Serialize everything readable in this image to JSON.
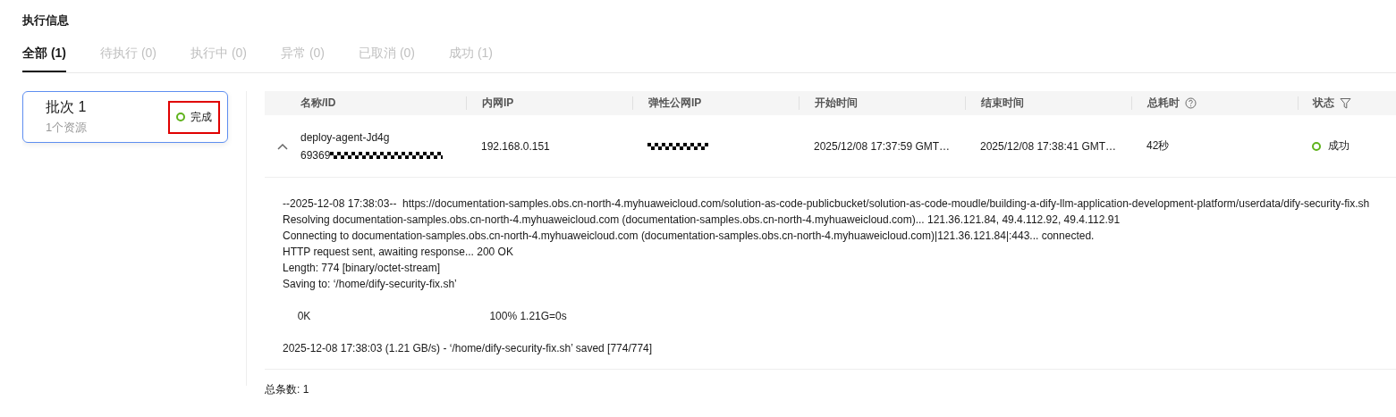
{
  "section_title": "执行信息",
  "tabs": [
    {
      "label": "全部 (1)",
      "selected": true
    },
    {
      "label": "待执行 (0)",
      "selected": false
    },
    {
      "label": "执行中 (0)",
      "selected": false
    },
    {
      "label": "异常 (0)",
      "selected": false
    },
    {
      "label": "已取消 (0)",
      "selected": false
    },
    {
      "label": "成功 (1)",
      "selected": false
    }
  ],
  "batches": [
    {
      "name": "批次 1",
      "resources": "1个资源",
      "status": "完成",
      "selected": true,
      "highlighted": true
    }
  ],
  "table": {
    "columns": [
      "名称/ID",
      "内网IP",
      "弹性公网IP",
      "开始时间",
      "结束时间",
      "总耗时",
      "状态"
    ],
    "rows": [
      {
        "expanded": true,
        "name": "deploy-agent-Jd4g",
        "id": "69369",
        "private_ip": "192.168.0.151",
        "start": "2025/12/08 17:37:59 GMT…",
        "end": "2025/12/08 17:38:41 GMT…",
        "duration": "42秒",
        "status": "成功",
        "log": [
          [
            "--2025-12-08 17:38:03--  https://documentation-samples.obs.cn-north-4.myhuaweicloud.com/solution-as-code-publicbucket/solution-as-code-moudle/building-a-dify-llm-application-development-platform/userdata/dify-security-fix.sh",
            "Resolving documentation-samples.obs.cn-north-4.myhuaweicloud.com (documentation-samples.obs.cn-north-4.myhuaweicloud.com)... 121.36.121.84, 49.4.112.92, 49.4.112.91",
            "Connecting to documentation-samples.obs.cn-north-4.myhuaweicloud.com (documentation-samples.obs.cn-north-4.myhuaweicloud.com)|121.36.121.84|:443... connected.",
            "HTTP request sent, awaiting response... 200 OK",
            "Length: 774 [binary/octet-stream]",
            "Saving to: ‘/home/dify-security-fix.sh’"
          ],
          [
            "     0K                                                            100% 1.21G=0s"
          ],
          [
            "2025-12-08 17:38:03 (1.21 GB/s) - ‘/home/dify-security-fix.sh’ saved [774/774]"
          ]
        ]
      }
    ]
  },
  "total": "总条数: 1"
}
